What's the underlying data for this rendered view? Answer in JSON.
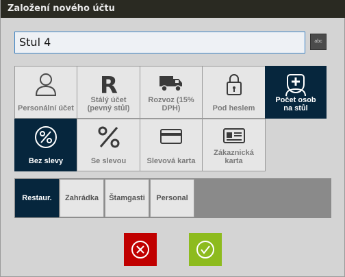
{
  "window": {
    "title": "Založení nového účtu"
  },
  "account_name": {
    "value": "Stul 4"
  },
  "keyboard_button": {
    "label": "abc"
  },
  "tiles": [
    {
      "label": "Personální účet",
      "icon": "person-icon"
    },
    {
      "label": "Stálý účet (pevný stůl)",
      "icon": "letter-r-icon"
    },
    {
      "label": "Rozvoz (15% DPH)",
      "icon": "truck-icon"
    },
    {
      "label": "Pod heslem",
      "icon": "lock-icon"
    },
    {
      "label": "Počet osob na stůl",
      "icon": "person-add-icon",
      "active": true
    },
    {
      "label": "Bez slevy",
      "icon": "percent-circle-icon",
      "active": true
    },
    {
      "label": "Se slevou",
      "icon": "percent-icon"
    },
    {
      "label": "Slevová karta",
      "icon": "card-icon"
    },
    {
      "label": "Zákaznická karta",
      "icon": "id-card-icon"
    }
  ],
  "tabs": [
    {
      "label": "Restaur.",
      "active": true
    },
    {
      "label": "Zahrádka"
    },
    {
      "label": "Štamgasti"
    },
    {
      "label": "Personal"
    }
  ],
  "buttons": {
    "cancel_icon": "close-circle-icon",
    "ok_icon": "check-circle-icon"
  },
  "colors": {
    "accent_dark": "#06263d",
    "cancel": "#c00000",
    "ok": "#8dbb1e",
    "titlebar": "#2a2a22"
  }
}
